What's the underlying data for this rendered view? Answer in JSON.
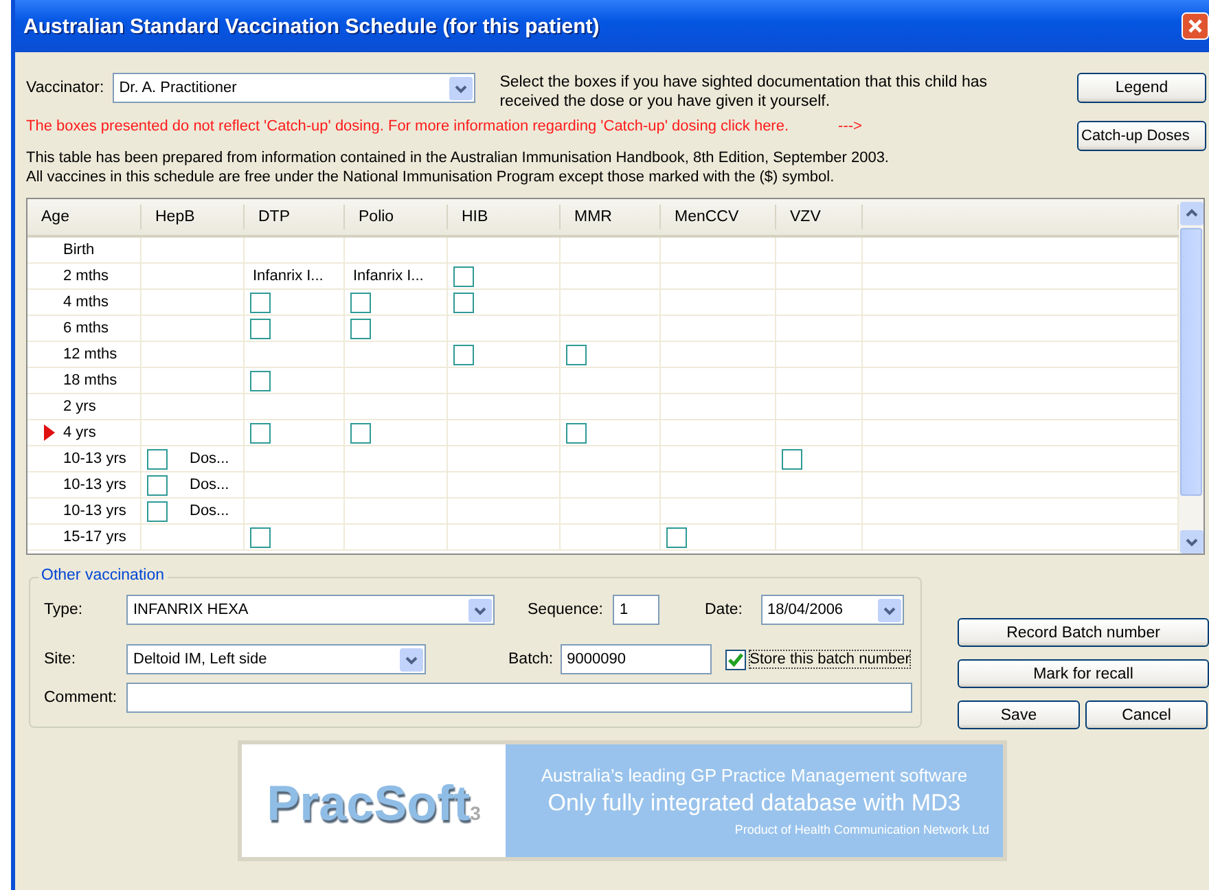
{
  "window": {
    "title": "Australian Standard Vaccination Schedule (for this patient)"
  },
  "vaccinator": {
    "label": "Vaccinator:",
    "value": "Dr. A. Practitioner"
  },
  "instructions": "Select the boxes if you have sighted documentation that this child has received the dose or you have given it yourself.",
  "catchup_notice": {
    "text": "The boxes presented do not reflect 'Catch-up' dosing.  For more information regarding 'Catch-up' dosing click here.",
    "arrow": "--->"
  },
  "info_lines": [
    "This table has been prepared from information contained in the Australian Immunisation Handbook, 8th Edition, September 2003.",
    "All vaccines in this schedule are free under the National Immunisation Program except those marked with the ($) symbol."
  ],
  "side_buttons": [
    "Legend",
    "Catch-up Doses"
  ],
  "table": {
    "columns": [
      "Age",
      "HepB",
      "DTP",
      "Polio",
      "HIB",
      "MMR",
      "MenCCV",
      "VZV"
    ],
    "rows": [
      {
        "current": false,
        "cells": [
          {
            "kind": "age",
            "text": "Birth"
          },
          {
            "kind": "empty"
          },
          {
            "kind": "empty"
          },
          {
            "kind": "empty"
          },
          {
            "kind": "empty"
          },
          {
            "kind": "empty"
          },
          {
            "kind": "empty"
          },
          {
            "kind": "empty"
          }
        ]
      },
      {
        "current": false,
        "cells": [
          {
            "kind": "age",
            "text": "2 mths"
          },
          {
            "kind": "empty"
          },
          {
            "kind": "text",
            "text": "Infanrix I..."
          },
          {
            "kind": "text",
            "text": "Infanrix I..."
          },
          {
            "kind": "checkbox",
            "checked": false
          },
          {
            "kind": "empty"
          },
          {
            "kind": "empty"
          },
          {
            "kind": "empty"
          }
        ]
      },
      {
        "current": false,
        "cells": [
          {
            "kind": "age",
            "text": "4 mths"
          },
          {
            "kind": "empty"
          },
          {
            "kind": "checkbox",
            "checked": false
          },
          {
            "kind": "checkbox",
            "checked": false
          },
          {
            "kind": "checkbox",
            "checked": false
          },
          {
            "kind": "empty"
          },
          {
            "kind": "empty"
          },
          {
            "kind": "empty"
          }
        ]
      },
      {
        "current": false,
        "cells": [
          {
            "kind": "age",
            "text": "6 mths"
          },
          {
            "kind": "empty"
          },
          {
            "kind": "checkbox",
            "checked": false
          },
          {
            "kind": "checkbox",
            "checked": false
          },
          {
            "kind": "empty"
          },
          {
            "kind": "empty"
          },
          {
            "kind": "empty"
          },
          {
            "kind": "empty"
          }
        ]
      },
      {
        "current": false,
        "cells": [
          {
            "kind": "age",
            "text": "12 mths"
          },
          {
            "kind": "empty"
          },
          {
            "kind": "empty"
          },
          {
            "kind": "empty"
          },
          {
            "kind": "checkbox",
            "checked": false
          },
          {
            "kind": "checkbox",
            "checked": false
          },
          {
            "kind": "empty"
          },
          {
            "kind": "empty"
          }
        ]
      },
      {
        "current": false,
        "cells": [
          {
            "kind": "age",
            "text": "18 mths"
          },
          {
            "kind": "empty"
          },
          {
            "kind": "checkbox",
            "checked": false
          },
          {
            "kind": "empty"
          },
          {
            "kind": "empty"
          },
          {
            "kind": "empty"
          },
          {
            "kind": "empty"
          },
          {
            "kind": "empty"
          }
        ]
      },
      {
        "current": false,
        "cells": [
          {
            "kind": "age",
            "text": "2 yrs"
          },
          {
            "kind": "empty"
          },
          {
            "kind": "empty"
          },
          {
            "kind": "empty"
          },
          {
            "kind": "empty"
          },
          {
            "kind": "empty"
          },
          {
            "kind": "empty"
          },
          {
            "kind": "empty"
          }
        ]
      },
      {
        "current": true,
        "cells": [
          {
            "kind": "age",
            "text": "4 yrs"
          },
          {
            "kind": "empty"
          },
          {
            "kind": "checkbox",
            "checked": false
          },
          {
            "kind": "checkbox",
            "checked": false
          },
          {
            "kind": "empty"
          },
          {
            "kind": "checkbox",
            "checked": false
          },
          {
            "kind": "empty"
          },
          {
            "kind": "empty"
          }
        ]
      },
      {
        "current": false,
        "cells": [
          {
            "kind": "age",
            "text": "10-13 yrs"
          },
          {
            "kind": "checkbox_text",
            "checked": false,
            "text": "Dos..."
          },
          {
            "kind": "empty"
          },
          {
            "kind": "empty"
          },
          {
            "kind": "empty"
          },
          {
            "kind": "empty"
          },
          {
            "kind": "empty"
          },
          {
            "kind": "checkbox",
            "checked": false
          }
        ]
      },
      {
        "current": false,
        "cells": [
          {
            "kind": "age",
            "text": "10-13 yrs"
          },
          {
            "kind": "checkbox_text",
            "checked": false,
            "text": "Dos..."
          },
          {
            "kind": "empty"
          },
          {
            "kind": "empty"
          },
          {
            "kind": "empty"
          },
          {
            "kind": "empty"
          },
          {
            "kind": "empty"
          },
          {
            "kind": "empty"
          }
        ]
      },
      {
        "current": false,
        "cells": [
          {
            "kind": "age",
            "text": "10-13 yrs"
          },
          {
            "kind": "checkbox_text",
            "checked": false,
            "text": "Dos..."
          },
          {
            "kind": "empty"
          },
          {
            "kind": "empty"
          },
          {
            "kind": "empty"
          },
          {
            "kind": "empty"
          },
          {
            "kind": "empty"
          },
          {
            "kind": "empty"
          }
        ]
      },
      {
        "current": false,
        "cells": [
          {
            "kind": "age",
            "text": "15-17 yrs"
          },
          {
            "kind": "empty"
          },
          {
            "kind": "checkbox",
            "checked": false
          },
          {
            "kind": "empty"
          },
          {
            "kind": "empty"
          },
          {
            "kind": "empty"
          },
          {
            "kind": "checkbox",
            "checked": false
          },
          {
            "kind": "empty"
          }
        ]
      }
    ]
  },
  "other_vaccination": {
    "title": "Other vaccination",
    "type": {
      "label": "Type:",
      "value": "INFANRIX HEXA"
    },
    "sequence": {
      "label": "Sequence:",
      "value": "1"
    },
    "date": {
      "label": "Date:",
      "value": "18/04/2006"
    },
    "site": {
      "label": "Site:",
      "value": "Deltoid IM, Left side"
    },
    "batch": {
      "label": "Batch:",
      "value": "9000090"
    },
    "store_batch": {
      "label": "Store this batch number",
      "checked": true
    },
    "comment": {
      "label": "Comment:"
    }
  },
  "action_buttons": {
    "record_batch": "Record Batch number",
    "mark_recall": "Mark for recall",
    "save": "Save",
    "cancel": "Cancel"
  },
  "banner": {
    "logo": "PracSoft",
    "logo_suffix": "3",
    "lines": [
      "Australia’s leading GP Practice Management software",
      "Only fully integrated database with MD3",
      "Product of Health Communication Network Ltd"
    ]
  }
}
